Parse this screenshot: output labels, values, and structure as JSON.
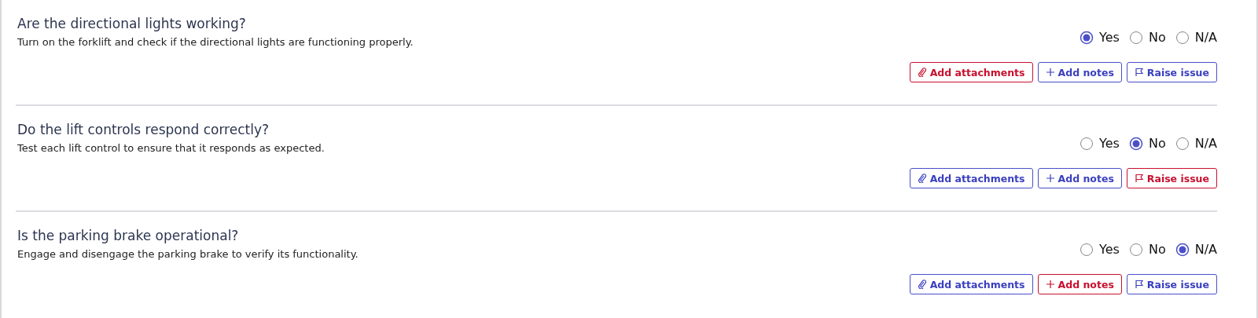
{
  "questions": [
    {
      "title": "Are the directional lights working?",
      "description": "Turn on the forklift and check if the directional lights are functioning properly.",
      "options": [
        {
          "label": "Yes",
          "selected": true
        },
        {
          "label": "No",
          "selected": false
        },
        {
          "label": "N/A",
          "selected": false
        }
      ],
      "actions": [
        {
          "kind": "attach",
          "label": "Add attachments",
          "required": true
        },
        {
          "kind": "notes",
          "label": "Add notes",
          "required": false
        },
        {
          "kind": "issue",
          "label": "Raise issue",
          "required": false
        }
      ]
    },
    {
      "title": "Do the lift controls respond correctly?",
      "description": "Test each lift control to ensure that it responds as expected.",
      "options": [
        {
          "label": "Yes",
          "selected": false
        },
        {
          "label": "No",
          "selected": true
        },
        {
          "label": "N/A",
          "selected": false
        }
      ],
      "actions": [
        {
          "kind": "attach",
          "label": "Add attachments",
          "required": false
        },
        {
          "kind": "notes",
          "label": "Add notes",
          "required": false
        },
        {
          "kind": "issue",
          "label": "Raise issue",
          "required": true
        }
      ]
    },
    {
      "title": "Is the parking brake operational?",
      "description": "Engage and disengage the parking brake to verify its functionality.",
      "options": [
        {
          "label": "Yes",
          "selected": false
        },
        {
          "label": "No",
          "selected": false
        },
        {
          "label": "N/A",
          "selected": true
        }
      ],
      "actions": [
        {
          "kind": "attach",
          "label": "Add attachments",
          "required": false
        },
        {
          "kind": "notes",
          "label": "Add notes",
          "required": true
        },
        {
          "kind": "issue",
          "label": "Raise issue",
          "required": false
        }
      ]
    }
  ]
}
